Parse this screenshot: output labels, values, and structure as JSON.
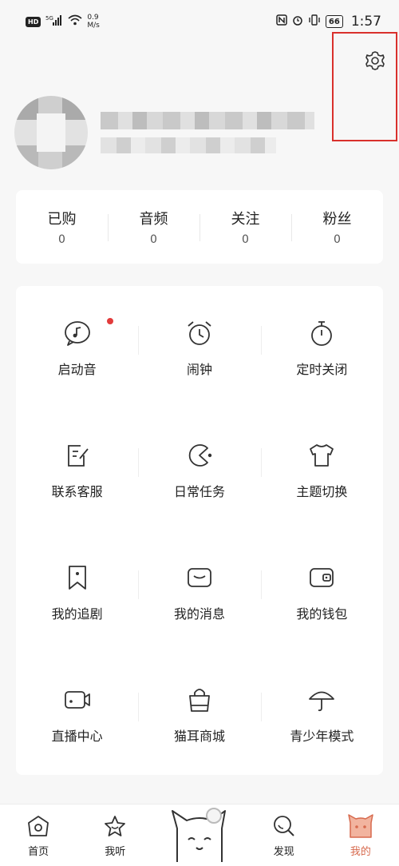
{
  "status_bar": {
    "hd": "HD",
    "signal": "5G",
    "speed_value": "0.9",
    "speed_unit": "M/s",
    "battery": "66",
    "time": "1:57"
  },
  "settings": {
    "icon": "gear-icon"
  },
  "stats": [
    {
      "label": "已购",
      "value": "0"
    },
    {
      "label": "音频",
      "value": "0"
    },
    {
      "label": "关注",
      "value": "0"
    },
    {
      "label": "粉丝",
      "value": "0"
    }
  ],
  "menu": [
    {
      "label": "启动音",
      "icon": "music-bubble-icon",
      "badge": true
    },
    {
      "label": "闹钟",
      "icon": "alarm-clock-icon"
    },
    {
      "label": "定时关闭",
      "icon": "stopwatch-icon"
    },
    {
      "label": "联系客服",
      "icon": "edit-note-icon"
    },
    {
      "label": "日常任务",
      "icon": "pacman-icon"
    },
    {
      "label": "主题切换",
      "icon": "tshirt-icon"
    },
    {
      "label": "我的追剧",
      "icon": "bookmark-icon"
    },
    {
      "label": "我的消息",
      "icon": "message-icon"
    },
    {
      "label": "我的钱包",
      "icon": "wallet-icon"
    },
    {
      "label": "直播中心",
      "icon": "video-camera-icon"
    },
    {
      "label": "猫耳商城",
      "icon": "shopping-bag-icon"
    },
    {
      "label": "青少年模式",
      "icon": "umbrella-icon"
    }
  ],
  "nav": {
    "home": "首页",
    "listen": "我听",
    "discover": "发现",
    "mine": "我的"
  },
  "colors": {
    "accent": "#d76a4e",
    "highlight": "#d9302c",
    "badge": "#e23b3b"
  }
}
